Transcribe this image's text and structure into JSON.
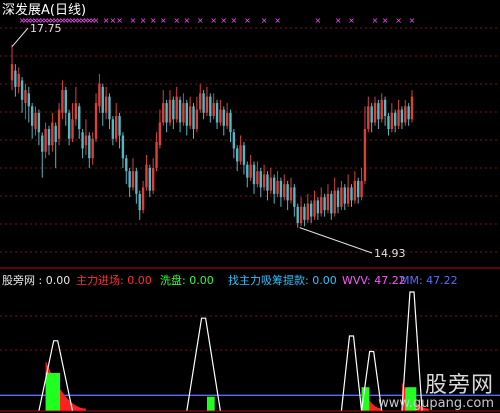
{
  "title": "深发展A(日线)",
  "colors": {
    "up": "#d9413a",
    "down": "#56b6c4",
    "marker": "#ff4dff",
    "grid": "#7a1515",
    "panel_line": "#b01010",
    "white": "#ffffff",
    "wvw": "#ff55ff",
    "mm": "#5a6cff",
    "red": "#ff2020",
    "green": "#20ff20",
    "cyan": "#30c0ff"
  },
  "chart_data": [
    {
      "type": "candlestick",
      "title": "深发展A(日线)",
      "x_count": 120,
      "ylim": [
        14.4,
        18.1
      ],
      "high_label": "17.75",
      "low_label": "14.93",
      "marker_symbol": "×",
      "marker_indices": [
        3,
        4,
        5,
        6,
        7,
        8,
        9,
        10,
        11,
        12,
        13,
        14,
        15,
        16,
        17,
        18,
        19,
        20,
        21,
        22,
        23,
        24,
        25,
        28,
        30,
        32,
        36,
        39,
        42,
        45,
        49,
        52,
        56,
        60,
        63,
        66,
        70,
        75,
        79,
        91,
        97,
        101,
        108,
        111,
        115,
        119
      ],
      "candles": [
        [
          17.2,
          17.45,
          17.75,
          17.05
        ],
        [
          17.35,
          17.1,
          17.45,
          16.95
        ],
        [
          17.1,
          17.3,
          17.4,
          17.0
        ],
        [
          17.2,
          16.9,
          17.25,
          16.7
        ],
        [
          16.85,
          17.05,
          17.15,
          16.6
        ],
        [
          17.0,
          16.8,
          17.1,
          16.55
        ],
        [
          16.8,
          16.5,
          16.85,
          16.3
        ],
        [
          16.45,
          16.7,
          16.8,
          16.35
        ],
        [
          16.7,
          16.4,
          16.75,
          16.2
        ],
        [
          16.35,
          16.1,
          16.4,
          15.7
        ],
        [
          16.1,
          16.45,
          16.55,
          16.0
        ],
        [
          16.45,
          16.2,
          16.5,
          16.05
        ],
        [
          16.2,
          16.55,
          16.7,
          16.1
        ],
        [
          16.5,
          16.25,
          16.55,
          15.85
        ],
        [
          16.3,
          16.75,
          16.85,
          16.2
        ],
        [
          16.7,
          17.05,
          17.2,
          16.6
        ],
        [
          17.05,
          16.7,
          17.1,
          16.5
        ],
        [
          16.7,
          16.3,
          16.75,
          16.2
        ],
        [
          16.3,
          16.6,
          16.85,
          16.25
        ],
        [
          16.6,
          16.85,
          17.1,
          16.5
        ],
        [
          16.8,
          16.45,
          16.85,
          16.3
        ],
        [
          16.4,
          16.15,
          16.45,
          16.0
        ],
        [
          16.2,
          16.35,
          16.6,
          16.05
        ],
        [
          16.35,
          16.0,
          16.4,
          15.85
        ],
        [
          16.0,
          16.3,
          16.4,
          15.9
        ],
        [
          16.3,
          16.85,
          17.0,
          16.25
        ],
        [
          16.8,
          17.15,
          17.3,
          16.7
        ],
        [
          17.1,
          16.7,
          17.15,
          16.5
        ],
        [
          16.7,
          16.95,
          17.1,
          16.6
        ],
        [
          16.95,
          16.6,
          17.0,
          16.45
        ],
        [
          16.6,
          16.3,
          16.65,
          16.2
        ],
        [
          16.3,
          16.65,
          16.85,
          16.25
        ],
        [
          16.65,
          16.35,
          16.7,
          16.15
        ],
        [
          16.35,
          16.0,
          16.4,
          15.85
        ],
        [
          16.0,
          15.8,
          16.05,
          15.6
        ],
        [
          15.8,
          15.55,
          15.85,
          15.4
        ],
        [
          15.55,
          15.8,
          16.0,
          15.5
        ],
        [
          15.8,
          15.45,
          15.85,
          15.3
        ],
        [
          15.45,
          15.2,
          15.5,
          15.05
        ],
        [
          15.2,
          15.55,
          15.65,
          15.15
        ],
        [
          15.55,
          15.9,
          16.05,
          15.5
        ],
        [
          15.85,
          15.5,
          15.9,
          15.4
        ],
        [
          15.5,
          15.85,
          16.0,
          15.45
        ],
        [
          15.85,
          16.25,
          16.4,
          15.8
        ],
        [
          16.2,
          16.55,
          16.75,
          16.15
        ],
        [
          16.55,
          16.85,
          17.05,
          16.5
        ],
        [
          16.85,
          16.55,
          16.9,
          16.4
        ],
        [
          16.55,
          16.9,
          17.05,
          16.5
        ],
        [
          16.9,
          16.6,
          16.95,
          16.45
        ],
        [
          16.6,
          16.95,
          17.1,
          16.55
        ],
        [
          16.9,
          16.55,
          16.95,
          16.4
        ],
        [
          16.55,
          16.85,
          17.0,
          16.5
        ],
        [
          16.85,
          16.5,
          16.9,
          16.35
        ],
        [
          16.5,
          16.8,
          16.95,
          16.45
        ],
        [
          16.8,
          16.45,
          16.85,
          16.3
        ],
        [
          16.45,
          16.75,
          16.95,
          16.4
        ],
        [
          16.75,
          17.0,
          17.15,
          16.7
        ],
        [
          17.0,
          16.7,
          17.05,
          16.6
        ],
        [
          16.7,
          16.95,
          17.1,
          16.65
        ],
        [
          16.95,
          16.65,
          17.0,
          16.55
        ],
        [
          16.65,
          16.85,
          17.0,
          16.6
        ],
        [
          16.85,
          16.55,
          16.9,
          16.45
        ],
        [
          16.55,
          16.75,
          16.9,
          16.5
        ],
        [
          16.75,
          16.5,
          16.8,
          16.35
        ],
        [
          16.5,
          16.7,
          16.85,
          16.45
        ],
        [
          16.7,
          16.4,
          16.75,
          16.25
        ],
        [
          16.4,
          16.15,
          16.45,
          16.0
        ],
        [
          16.15,
          15.95,
          16.2,
          15.8
        ],
        [
          15.95,
          16.2,
          16.35,
          15.9
        ],
        [
          16.2,
          15.9,
          16.25,
          15.75
        ],
        [
          15.9,
          15.7,
          15.95,
          15.55
        ],
        [
          15.7,
          15.9,
          16.05,
          15.65
        ],
        [
          15.9,
          15.6,
          15.95,
          15.45
        ],
        [
          15.6,
          15.8,
          15.95,
          15.55
        ],
        [
          15.8,
          15.55,
          15.85,
          15.4
        ],
        [
          15.55,
          15.75,
          15.9,
          15.5
        ],
        [
          15.75,
          15.5,
          15.8,
          15.35
        ],
        [
          15.5,
          15.7,
          15.85,
          15.45
        ],
        [
          15.7,
          15.45,
          15.75,
          15.3
        ],
        [
          15.45,
          15.65,
          15.8,
          15.4
        ],
        [
          15.65,
          15.4,
          15.7,
          15.25
        ],
        [
          15.4,
          15.6,
          15.75,
          15.35
        ],
        [
          15.6,
          15.35,
          15.65,
          15.2
        ],
        [
          15.35,
          15.55,
          15.7,
          15.3
        ],
        [
          15.55,
          15.25,
          15.6,
          15.1
        ],
        [
          15.25,
          15.0,
          15.3,
          14.93
        ],
        [
          15.0,
          15.25,
          15.4,
          14.95
        ],
        [
          15.25,
          15.05,
          15.3,
          14.95
        ],
        [
          15.05,
          15.3,
          15.45,
          15.0
        ],
        [
          15.3,
          15.1,
          15.35,
          15.0
        ],
        [
          15.1,
          15.35,
          15.5,
          15.05
        ],
        [
          15.35,
          15.15,
          15.4,
          15.05
        ],
        [
          15.15,
          15.4,
          15.55,
          15.1
        ],
        [
          15.4,
          15.2,
          15.45,
          15.1
        ],
        [
          15.2,
          15.45,
          15.6,
          15.15
        ],
        [
          15.45,
          15.15,
          15.5,
          15.05
        ],
        [
          15.15,
          15.5,
          15.7,
          15.1
        ],
        [
          15.5,
          15.25,
          15.55,
          15.15
        ],
        [
          15.25,
          15.55,
          15.65,
          15.2
        ],
        [
          15.55,
          15.3,
          15.6,
          15.2
        ],
        [
          15.3,
          15.55,
          15.75,
          15.25
        ],
        [
          15.55,
          15.35,
          15.6,
          15.25
        ],
        [
          15.35,
          15.65,
          15.8,
          15.3
        ],
        [
          15.65,
          15.4,
          15.7,
          15.3
        ],
        [
          15.4,
          15.65,
          15.85,
          15.35
        ],
        [
          15.65,
          16.45,
          16.8,
          15.6
        ],
        [
          16.45,
          16.8,
          16.95,
          16.4
        ],
        [
          16.8,
          16.55,
          16.85,
          16.4
        ],
        [
          16.55,
          16.85,
          16.95,
          16.5
        ],
        [
          16.85,
          16.6,
          16.9,
          16.45
        ],
        [
          16.6,
          16.9,
          17.0,
          16.55
        ],
        [
          16.9,
          16.65,
          16.95,
          16.5
        ],
        [
          16.65,
          16.45,
          16.7,
          16.35
        ],
        [
          16.45,
          16.7,
          16.85,
          16.4
        ],
        [
          16.7,
          16.5,
          16.75,
          16.4
        ],
        [
          16.5,
          16.75,
          16.9,
          16.45
        ],
        [
          16.75,
          16.55,
          16.8,
          16.45
        ],
        [
          16.55,
          16.8,
          16.9,
          16.5
        ],
        [
          16.8,
          16.6,
          16.85,
          16.5
        ],
        [
          16.6,
          16.95,
          17.05,
          16.55
        ]
      ]
    },
    {
      "type": "line",
      "indicator_name": "股旁网",
      "legend": [
        {
          "label": "股旁网 : 0.00",
          "color": "#e8e8e8"
        },
        {
          "label": "主力进场: 0.00",
          "color": "#ff3030"
        },
        {
          "label": "洗盘: 0.00",
          "color": "#30ff30"
        },
        {
          "label": "找主力吸筹提款: 0.00",
          "color": "#30c0ff"
        },
        {
          "label": "WVV: 47.22",
          "color": "#ff55ff"
        },
        {
          "label": "MM: 47.22",
          "color": "#5a6cff"
        }
      ],
      "ylim": [
        0,
        100
      ],
      "mm_value": 47.22,
      "peaks": [
        {
          "center": 13,
          "half_width": 5,
          "height": 59
        },
        {
          "center": 57,
          "half_width": 5,
          "height": 78
        },
        {
          "center": 101,
          "half_width": 3,
          "height": 63
        },
        {
          "center": 107,
          "half_width": 3,
          "height": 50
        },
        {
          "center": 119,
          "half_width": 3,
          "height": 100
        }
      ],
      "red_fills": [
        {
          "start": 10,
          "end": 22,
          "height": 40
        },
        {
          "start": 104,
          "end": 110,
          "height": 18
        },
        {
          "start": 116,
          "end": 124,
          "height": 22
        }
      ],
      "green_fills": [
        {
          "start": 10,
          "end": 14,
          "height": 32
        },
        {
          "start": 58,
          "end": 60,
          "height": 12
        },
        {
          "start": 104,
          "end": 106,
          "height": 20
        },
        {
          "start": 117,
          "end": 120,
          "height": 20
        }
      ]
    }
  ],
  "watermark": {
    "cn": "股旁网",
    "url": "www.gupang.com"
  }
}
